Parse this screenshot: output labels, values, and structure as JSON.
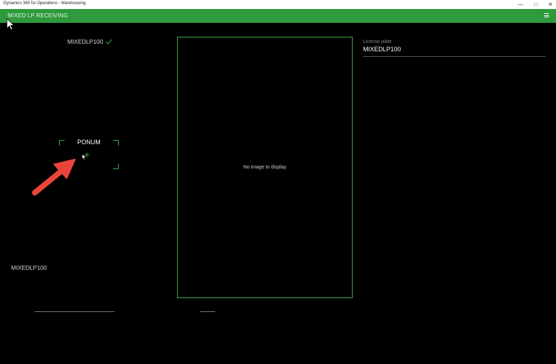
{
  "window": {
    "title": "Dynamics 365 for Operations - Warehousing",
    "minimize_glyph": "—",
    "maximize_glyph": "□",
    "close_glyph": "✕"
  },
  "appbar": {
    "title": "MIXED LP RECEIVING",
    "menu_icon": "hamburger-icon"
  },
  "left": {
    "license_plate_top": "MIXEDLP100",
    "scan_field_label": "PONUM",
    "license_plate_bottom": "MIXEDLP100"
  },
  "center": {
    "no_image_text": "No image to display"
  },
  "right": {
    "label": "License plate",
    "value": "MIXEDLP100"
  },
  "colors": {
    "accent": "#2e9a3c",
    "highlight": "#3fae49",
    "annotation": "#e8443a"
  }
}
